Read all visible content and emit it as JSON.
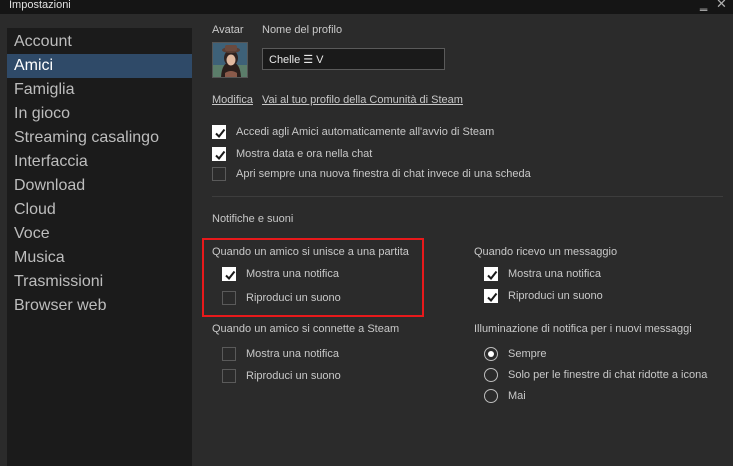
{
  "window": {
    "title": "Impostazioni",
    "minimize_glyph": "‗",
    "close_glyph": "✕"
  },
  "sidebar": {
    "items": [
      {
        "label": "Account",
        "active": false
      },
      {
        "label": "Amici",
        "active": true
      },
      {
        "label": "Famiglia",
        "active": false
      },
      {
        "label": "In gioco",
        "active": false
      },
      {
        "label": "Streaming casalingo",
        "active": false
      },
      {
        "label": "Interfaccia",
        "active": false
      },
      {
        "label": "Download",
        "active": false
      },
      {
        "label": "Cloud",
        "active": false
      },
      {
        "label": "Voce",
        "active": false
      },
      {
        "label": "Musica",
        "active": false
      },
      {
        "label": "Trasmissioni",
        "active": false
      },
      {
        "label": "Browser web",
        "active": false
      }
    ]
  },
  "profile": {
    "avatar_label": "Avatar",
    "name_label": "Nome del profilo",
    "name_value": "Chelle ☰ V",
    "edit_link": "Modifica",
    "community_link": "Vai al tuo profilo della Comunità di Steam"
  },
  "general_options": [
    {
      "label": "Accedi agli Amici automaticamente all'avvio di Steam",
      "checked": true
    },
    {
      "label": "Mostra data e ora nella chat",
      "checked": true
    },
    {
      "label": "Apri sempre una nuova finestra di chat invece di una scheda",
      "checked": false
    }
  ],
  "notifications": {
    "heading": "Notifiche e suoni",
    "game_join": {
      "title": "Quando un amico si unisce a una partita",
      "show_notification": {
        "label": "Mostra una notifica",
        "checked": true
      },
      "play_sound": {
        "label": "Riproduci un suono",
        "checked": false
      }
    },
    "message": {
      "title": "Quando ricevo un messaggio",
      "show_notification": {
        "label": "Mostra una notifica",
        "checked": true
      },
      "play_sound": {
        "label": "Riproduci un suono",
        "checked": true
      }
    },
    "connect": {
      "title": "Quando un amico si connette a Steam",
      "show_notification": {
        "label": "Mostra una notifica",
        "checked": false
      },
      "play_sound": {
        "label": "Riproduci un suono",
        "checked": false
      }
    },
    "flash": {
      "title": "Illuminazione di notifica per i nuovi messaggi",
      "options": [
        {
          "label": "Sempre",
          "selected": true
        },
        {
          "label": "Solo per le finestre di chat ridotte a icona",
          "selected": false
        },
        {
          "label": "Mai",
          "selected": false
        }
      ]
    }
  },
  "colors": {
    "accent": "#2f4a68",
    "highlight": "#e8191b"
  }
}
